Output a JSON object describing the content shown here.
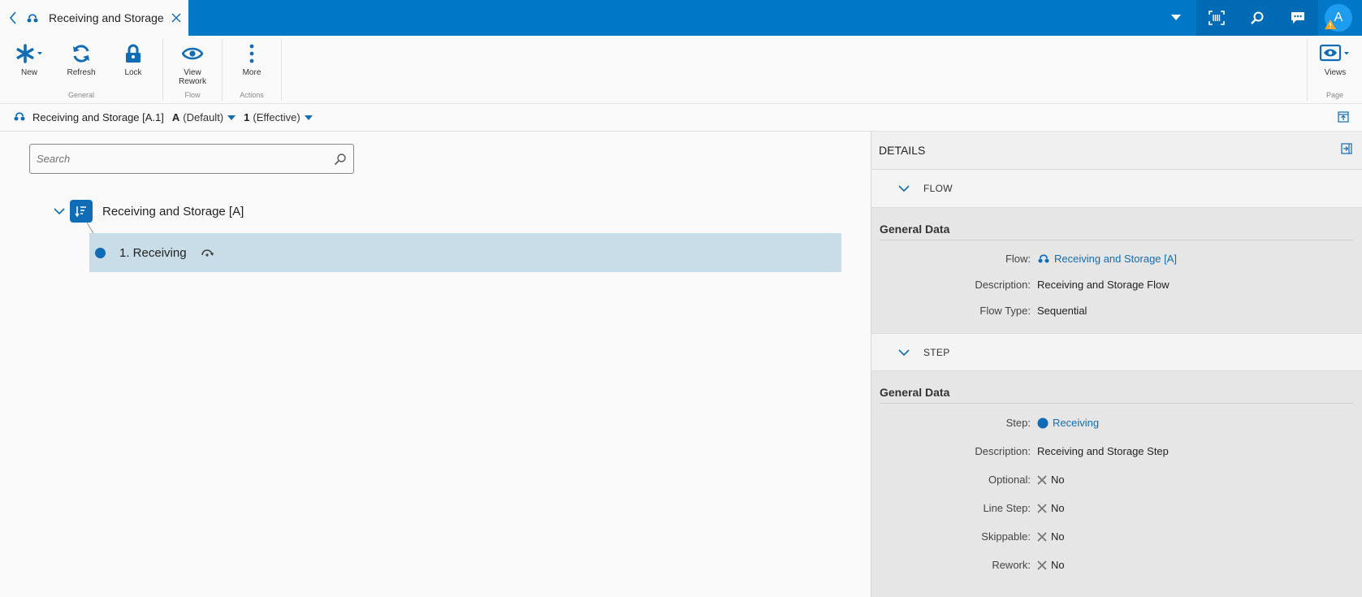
{
  "tab": {
    "title": "Receiving and Storage"
  },
  "ribbon": {
    "groups": [
      {
        "label": "General",
        "buttons": [
          {
            "label": "New"
          },
          {
            "label": "Refresh"
          },
          {
            "label": "Lock"
          }
        ]
      },
      {
        "label": "Flow",
        "buttons": [
          {
            "label": "View Rework"
          }
        ]
      },
      {
        "label": "Actions",
        "buttons": [
          {
            "label": "More"
          }
        ]
      },
      {
        "label": "Page",
        "buttons": [
          {
            "label": "Views"
          }
        ]
      }
    ]
  },
  "context": {
    "name": "Receiving and Storage [A.1]",
    "revision": "A",
    "revision_note": "(Default)",
    "version": "1",
    "version_note": "(Effective)"
  },
  "search": {
    "placeholder": "Search"
  },
  "tree": {
    "root_label": "Receiving and Storage [A]",
    "items": [
      {
        "label": "1. Receiving"
      }
    ]
  },
  "user": {
    "initial": "A"
  },
  "details": {
    "title": "DETAILS",
    "flow_section": {
      "header": "FLOW",
      "group_title": "General Data",
      "fields": [
        {
          "label": "Flow:",
          "value": "Receiving and Storage [A]"
        },
        {
          "label": "Description:",
          "value": "Receiving and Storage Flow"
        },
        {
          "label": "Flow Type:",
          "value": "Sequential"
        }
      ]
    },
    "step_section": {
      "header": "STEP",
      "group_title": "General Data",
      "fields": [
        {
          "label": "Step:",
          "value": "Receiving"
        },
        {
          "label": "Description:",
          "value": "Receiving and Storage Step"
        },
        {
          "label": "Optional:",
          "value": "No"
        },
        {
          "label": "Line Step:",
          "value": "No"
        },
        {
          "label": "Skippable:",
          "value": "No"
        },
        {
          "label": "Rework:",
          "value": "No"
        }
      ]
    }
  },
  "colors": {
    "brand": "#0078c8",
    "accent": "#0f6cb5",
    "selection": "#c9dde9"
  }
}
